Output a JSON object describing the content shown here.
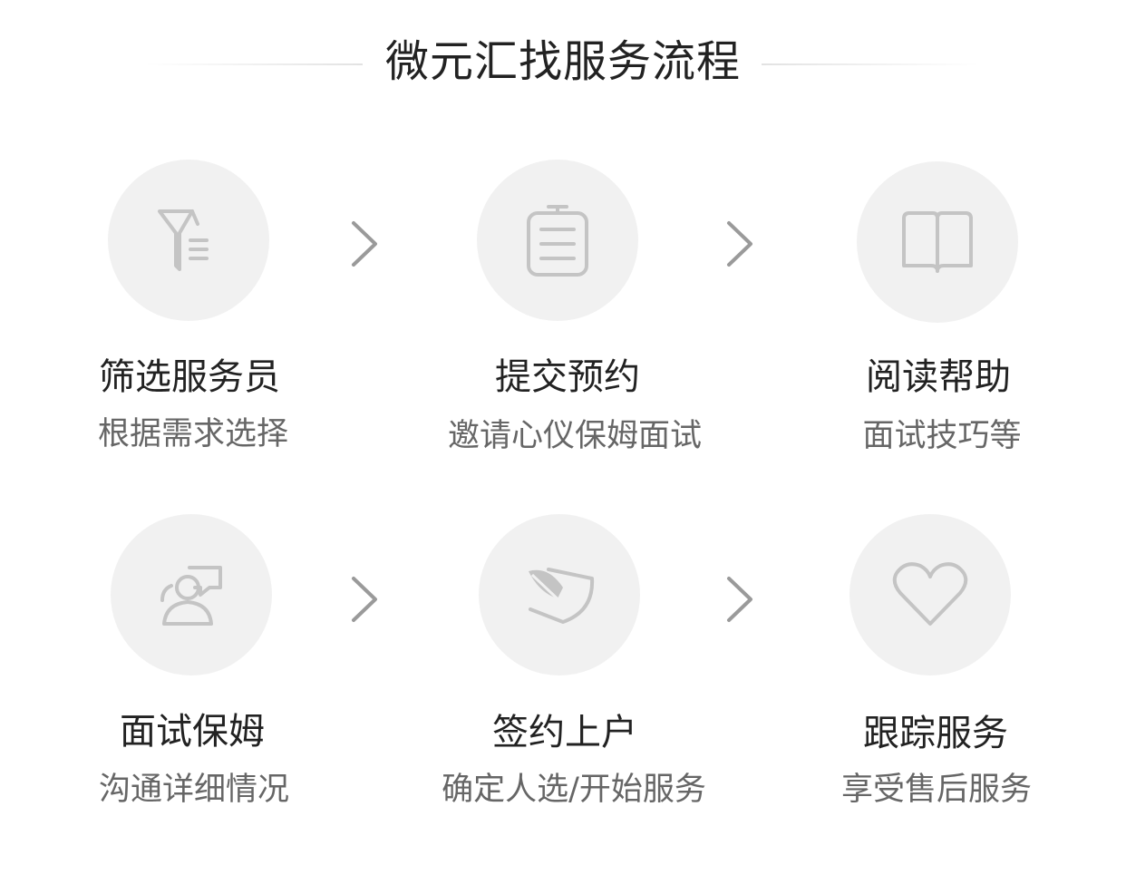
{
  "page_title": "微元汇找服务流程",
  "steps": [
    {
      "title": "筛选服务员",
      "desc": "根据需求选择",
      "icon": "filter-list-icon"
    },
    {
      "title": "提交预约",
      "desc": "邀请心仪保姆面试",
      "icon": "clipboard-icon"
    },
    {
      "title": "阅读帮助",
      "desc": "面试技巧等",
      "icon": "open-book-icon"
    },
    {
      "title": "面试保姆",
      "desc": "沟通详细情况",
      "icon": "person-chat-icon"
    },
    {
      "title": "签约上户",
      "desc": "确定人选/开始服务",
      "icon": "quill-sign-icon"
    },
    {
      "title": "跟踪服务",
      "desc": "享受售后服务",
      "icon": "heart-icon"
    }
  ],
  "colors": {
    "circle": "#f1f1f1",
    "icon": "#c4c4c4",
    "title": "#222222",
    "desc": "#666666",
    "arrow": "#9a9a9a"
  }
}
